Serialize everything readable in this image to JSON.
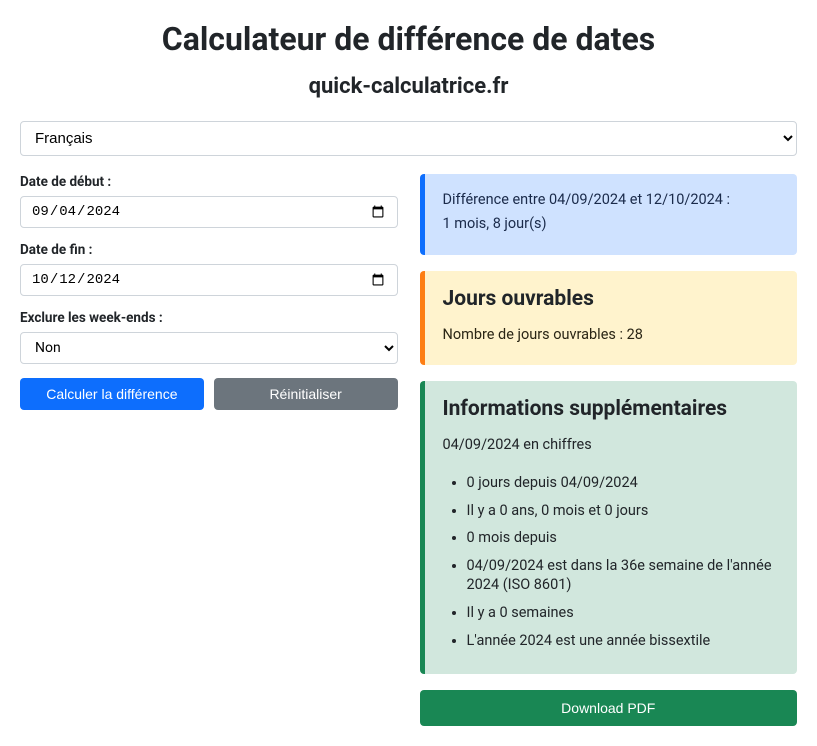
{
  "title": "Calculateur de différence de dates",
  "subtitle": "quick-calculatrice.fr",
  "language": {
    "selected": "Français"
  },
  "form": {
    "startLabel": "Date de début :",
    "startValue": "2024-09-04",
    "endLabel": "Date de fin :",
    "endValue": "2024-10-12",
    "excludeLabel": "Exclure les week-ends :",
    "excludeValue": "Non",
    "calcButton": "Calculer la différence",
    "resetButton": "Réinitialiser"
  },
  "results": {
    "diffLine1": "Différence entre 04/09/2024 et 12/10/2024 :",
    "diffLine2": "1 mois, 8 jour(s)",
    "workTitle": "Jours ouvrables",
    "workText": "Nombre de jours ouvrables : 28",
    "extraTitle": "Informations supplémentaires",
    "extraIntro": "04/09/2024 en chiffres",
    "items": {
      "0": "0 jours depuis 04/09/2024",
      "1": "Il y a 0 ans, 0 mois et 0 jours",
      "2": "0 mois depuis",
      "3": "04/09/2024 est dans la 36e semaine de l'année 2024 (ISO 8601)",
      "4": "Il y a 0 semaines",
      "5": "L'année 2024 est une année bissextile"
    },
    "downloadButton": "Download PDF"
  }
}
